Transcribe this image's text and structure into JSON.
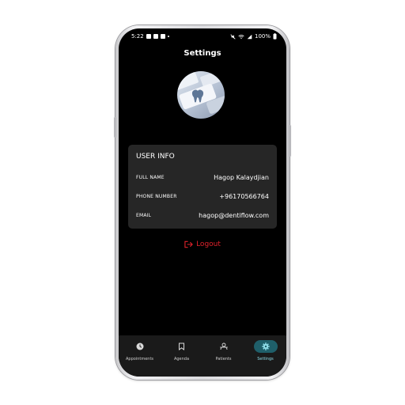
{
  "status_bar": {
    "time": "5:22",
    "battery": "100%"
  },
  "header": {
    "title": "Settings"
  },
  "profile": {
    "avatar_icon": "tooth-keyboard-image"
  },
  "user_info": {
    "title": "USER INFO",
    "rows": [
      {
        "label": "FULL NAME",
        "value": "Hagop Kalaydjian"
      },
      {
        "label": "PHONE NUMBER",
        "value": "+96170566764"
      },
      {
        "label": "EMAIL",
        "value": "hagop@dentiflow.com"
      }
    ]
  },
  "logout": {
    "label": "Logout",
    "icon": "logout-icon",
    "color": "#e0222b"
  },
  "bottom_nav": {
    "items": [
      {
        "label": "Appointments",
        "icon": "clock-icon"
      },
      {
        "label": "Agenda",
        "icon": "bookmark-icon"
      },
      {
        "label": "Patients",
        "icon": "patients-icon"
      },
      {
        "label": "Settings",
        "icon": "gear-icon",
        "active": true
      }
    ]
  },
  "colors": {
    "background": "#000000",
    "card": "#262626",
    "accent": "#1f5f6a",
    "accent_text": "#8fdde9"
  }
}
